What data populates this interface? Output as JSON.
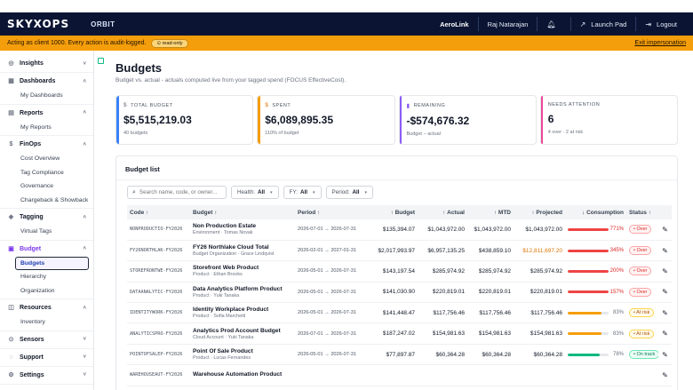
{
  "topbar": {
    "logo": "SKYXOPS",
    "product": "ORBIT",
    "org": "AeroLink",
    "user": "Raj Natarajan",
    "bell_icon": "bell-icon",
    "launch_pad": "Launch Pad",
    "logout": "Logout"
  },
  "banner": {
    "text": "Acting as client 1000. Every action is audit-logged.",
    "badge": "read-only",
    "exit": "Exit impersonation"
  },
  "sidebar": {
    "groups": [
      {
        "label": "Insights",
        "icon": "insights-icon",
        "glyph": "◎",
        "items": []
      },
      {
        "label": "Dashboards",
        "icon": "dashboard-icon",
        "glyph": "▦",
        "items": [
          "My Dashboards"
        ]
      },
      {
        "label": "Reports",
        "icon": "report-icon",
        "glyph": "▤",
        "items": [
          "My Reports"
        ]
      },
      {
        "label": "FinOps",
        "icon": "finops-icon",
        "glyph": "$",
        "items": [
          "Cost Overview",
          "Tag Compliance",
          "Governance",
          "Chargeback & Showback"
        ]
      },
      {
        "label": "Tagging",
        "icon": "tag-icon",
        "glyph": "◈",
        "items": [
          "Virtual Tags"
        ]
      },
      {
        "label": "Budget",
        "icon": "budget-icon",
        "glyph": "▣",
        "items": [
          "Budgets",
          "Hierarchy",
          "Organization"
        ]
      },
      {
        "label": "Resources",
        "icon": "resources-icon",
        "glyph": "◫",
        "items": [
          "Inventory"
        ]
      },
      {
        "label": "Sensors",
        "icon": "sensor-icon",
        "glyph": "⊙",
        "items": []
      },
      {
        "label": "Support",
        "icon": "support-icon",
        "glyph": "◌",
        "items": []
      },
      {
        "label": "Settings",
        "icon": "gear-icon",
        "glyph": "⚙",
        "items": []
      }
    ]
  },
  "page": {
    "title": "Budgets",
    "subtitle": "Budget vs. actual - actuals computed live from your tagged spend (FOCUS EffectiveCost)."
  },
  "cards": [
    {
      "label": "TOTAL BUDGET",
      "value": "$5,515,219.03",
      "note": "40 budgets"
    },
    {
      "label": "SPENT",
      "value": "$6,089,895.35",
      "note": "110% of budget"
    },
    {
      "label": "REMAINING",
      "value": "-$574,676.32",
      "note": "Budget − actual"
    },
    {
      "label": "NEEDS ATTENTION",
      "value": "6",
      "note": "4 over · 2 at risk"
    }
  ],
  "list": {
    "title": "Budget list",
    "search_placeholder": "Search name, code, or owner...",
    "filters": [
      {
        "label": "Health:",
        "value": "All"
      },
      {
        "label": "FY:",
        "value": "All"
      },
      {
        "label": "Period:",
        "value": "All"
      }
    ],
    "columns": [
      "Code",
      "Budget",
      "Period",
      "Budget",
      "Actual",
      "MTD",
      "Projected",
      "Consumption",
      "Status"
    ],
    "rows": [
      {
        "code": "NONPRODUCTIO-FY2026",
        "name": "Non Production Estate",
        "sub": "Environment · Tomas Novak",
        "period": "2026-07-01 → 2026-07-31",
        "budget": "$135,394.07",
        "actual": "$1,043,972.00",
        "mtd": "$1,043,972.00",
        "projected": "$1,043,972.00",
        "proj_over": false,
        "pct": "771%",
        "fill": 1.0,
        "bar_color": "#ef4444",
        "status": "Over"
      },
      {
        "code": "FY26NORTHLAK-FY2026",
        "name": "FY26 Northlake Cloud Total",
        "sub": "Budget Organization · Grace Lindqvist",
        "period": "2026-02-01 → 2027-01-31",
        "budget": "$2,017,993.97",
        "actual": "$6,957,135.25",
        "mtd": "$438,859.10",
        "projected": "$12,811,697.20",
        "proj_over": true,
        "pct": "345%",
        "fill": 1.0,
        "bar_color": "#ef4444",
        "status": "Over"
      },
      {
        "code": "STOREFRONTWE-FY2026",
        "name": "Storefront Web Product",
        "sub": "Product · Ethan Brooks",
        "period": "2026-05-01 → 2026-07-31",
        "budget": "$143,197.54",
        "actual": "$285,974.92",
        "mtd": "$285,974.92",
        "projected": "$285,974.92",
        "proj_over": false,
        "pct": "200%",
        "fill": 1.0,
        "bar_color": "#ef4444",
        "status": "Over"
      },
      {
        "code": "DATAANALYTIC-FY2026",
        "name": "Data Analytics Platform Product",
        "sub": "Product · Yuki Tanaka",
        "period": "2026-05-01 → 2026-07-31",
        "budget": "$141,030.90",
        "actual": "$220,819.01",
        "mtd": "$220,819.01",
        "projected": "$220,819.01",
        "proj_over": false,
        "pct": "157%",
        "fill": 1.0,
        "bar_color": "#ef4444",
        "status": "Over"
      },
      {
        "code": "IDENTITYWORK-FY2026",
        "name": "Identity Workplace Product",
        "sub": "Product · Sofia Marchetti",
        "period": "2026-05-01 → 2026-07-31",
        "budget": "$141,448.47",
        "actual": "$117,756.46",
        "mtd": "$117,756.46",
        "projected": "$117,756.46",
        "proj_over": false,
        "pct": "83%",
        "fill": 0.83,
        "bar_color": "#f59e0b",
        "status": "At risk"
      },
      {
        "code": "ANALYTICSPRO-FY2026",
        "name": "Analytics Prod Account Budget",
        "sub": "Cloud Account · Yuki Tanaka",
        "period": "2026-07-01 → 2026-07-31",
        "budget": "$187,247.02",
        "actual": "$154,981.63",
        "mtd": "$154,981.63",
        "projected": "$154,981.63",
        "proj_over": false,
        "pct": "83%",
        "fill": 0.83,
        "bar_color": "#f59e0b",
        "status": "At risk"
      },
      {
        "code": "POINTOFSALEP-FY2026",
        "name": "Point Of Sale Product",
        "sub": "Product · Lucas Fernandes",
        "period": "2026-05-01 → 2026-07-31",
        "budget": "$77,897.87",
        "actual": "$60,364.28",
        "mtd": "$60,364.28",
        "projected": "$60,364.28",
        "proj_over": false,
        "pct": "78%",
        "fill": 0.78,
        "bar_color": "#10b981",
        "status": "On track"
      },
      {
        "code": "WAREHOUSEAUT-FY2026",
        "name": "Warehouse Automation Product",
        "sub": "",
        "period": "",
        "budget": "",
        "actual": "",
        "mtd": "",
        "projected": "",
        "proj_over": false,
        "pct": "",
        "fill": 0.0,
        "bar_color": "#10b981",
        "status": ""
      }
    ],
    "status_colors": {
      "Over": {
        "fg": "#dc2626",
        "bg": "#fef2f2",
        "border": "#fca5a5"
      },
      "At risk": {
        "fg": "#b45309",
        "bg": "#fffbeb",
        "border": "#fcd34d"
      },
      "On track": {
        "fg": "#047857",
        "bg": "#ecfdf5",
        "border": "#6ee7b7"
      }
    }
  }
}
